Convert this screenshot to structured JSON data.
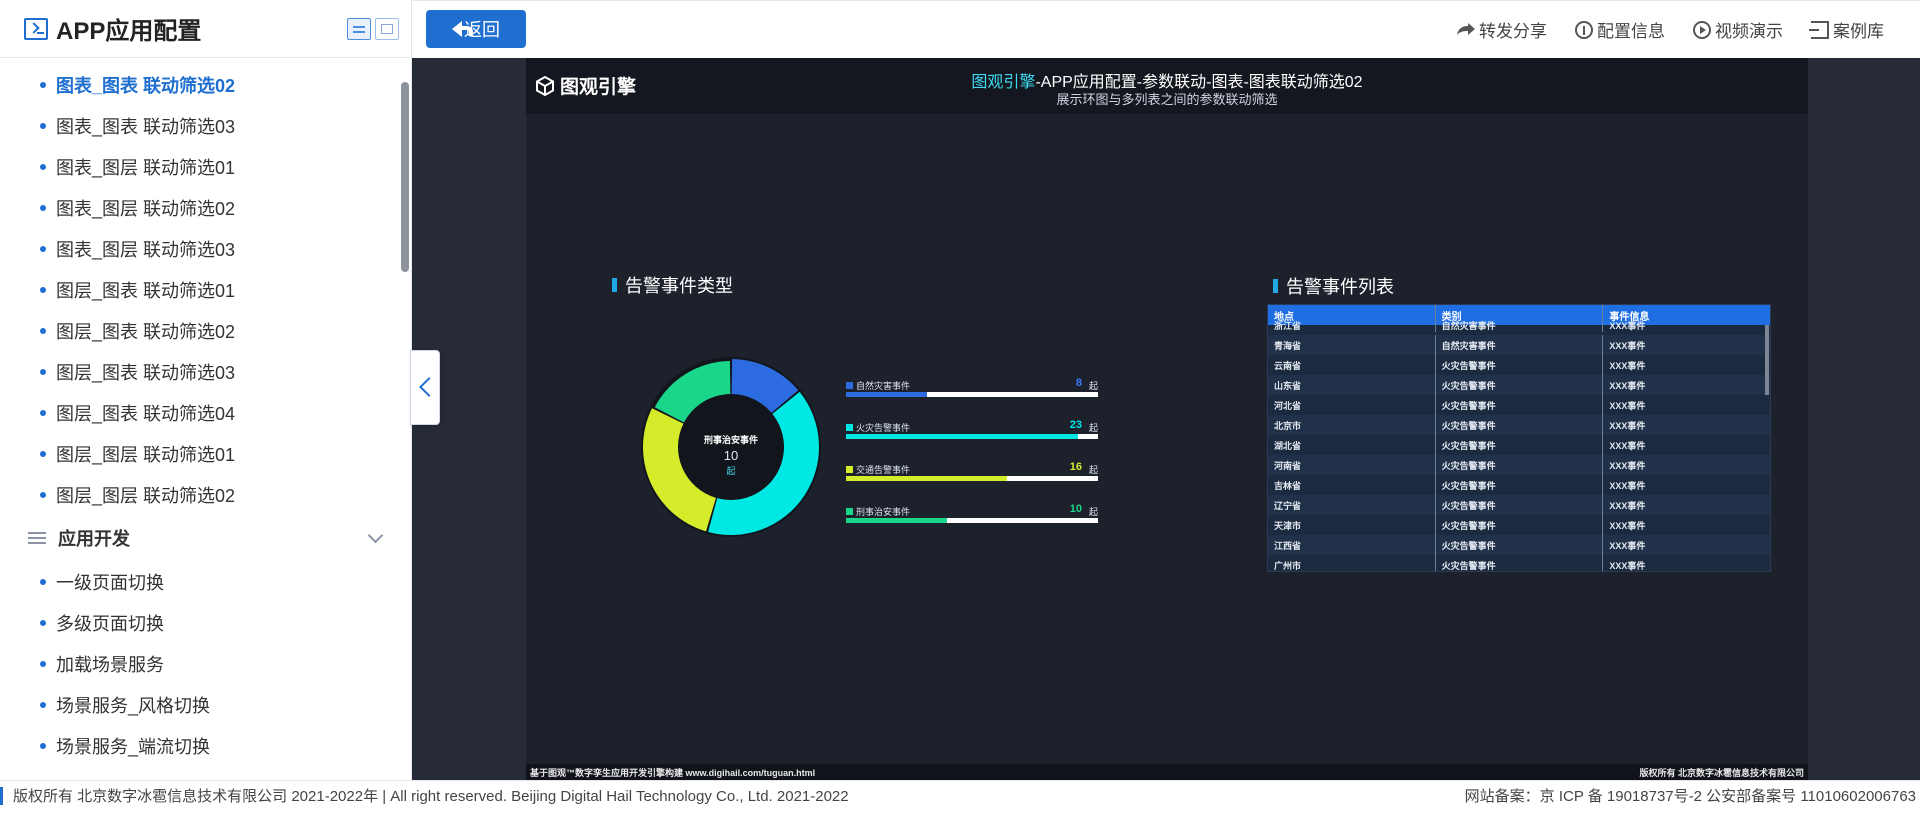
{
  "sidebar": {
    "title": "APP应用配置",
    "items": [
      {
        "label": "图表_图表 联动筛选02",
        "active": true
      },
      {
        "label": "图表_图表 联动筛选03"
      },
      {
        "label": "图表_图层 联动筛选01"
      },
      {
        "label": "图表_图层 联动筛选02"
      },
      {
        "label": "图表_图层 联动筛选03"
      },
      {
        "label": "图层_图表 联动筛选01"
      },
      {
        "label": "图层_图表 联动筛选02"
      },
      {
        "label": "图层_图表 联动筛选03"
      },
      {
        "label": "图层_图表 联动筛选04"
      },
      {
        "label": "图层_图层 联动筛选01"
      },
      {
        "label": "图层_图层 联动筛选02"
      }
    ],
    "group": {
      "label": "应用开发"
    },
    "group_items": [
      {
        "label": "一级页面切换"
      },
      {
        "label": "多级页面切换"
      },
      {
        "label": "加载场景服务"
      },
      {
        "label": "场景服务_风格切换"
      },
      {
        "label": "场景服务_端流切换"
      }
    ]
  },
  "topbar": {
    "back_label": "返回",
    "actions": [
      "转发分享",
      "配置信息",
      "视频演示",
      "案例库"
    ]
  },
  "dashboard": {
    "logo": "图观引擎",
    "title_highlight": "图观引擎",
    "title_rest": "-APP应用配置-参数联动-图表-图表联动筛选02",
    "subtitle": "展示环图与多列表之间的参数联动筛选",
    "left_panel_title": "告警事件类型",
    "right_panel_title": "告警事件列表",
    "footer_left": "基于图观™数字孪生应用开发引擎构建 www.digihail.com/tuguan.html",
    "footer_right": "版权所有 北京数字冰雹信息技术有限公司",
    "center_label": "刑事治安事件",
    "center_value": "10",
    "center_unit": "起"
  },
  "chart_data": {
    "type": "pie",
    "variant": "donut",
    "unit": "起",
    "categories": [
      "自然灾害事件",
      "火灾告警事件",
      "交通告警事件",
      "刑事治安事件"
    ],
    "values": [
      8,
      23,
      16,
      10
    ],
    "colors": [
      "#2d6ce0",
      "#00e8e4",
      "#d4ec2a",
      "#1ad68a"
    ],
    "value_colors": [
      "#3f7bff",
      "#00e8e4",
      "#d4ec2a",
      "#1ad68a"
    ],
    "highlight": "刑事治安事件"
  },
  "table": {
    "headers": [
      "地点",
      "类别",
      "事件信息"
    ],
    "rows": [
      [
        "浙江省",
        "自然灾害事件",
        "XXX事件"
      ],
      [
        "青海省",
        "自然灾害事件",
        "XXX事件"
      ],
      [
        "云南省",
        "火灾告警事件",
        "XXX事件"
      ],
      [
        "山东省",
        "火灾告警事件",
        "XXX事件"
      ],
      [
        "河北省",
        "火灾告警事件",
        "XXX事件"
      ],
      [
        "北京市",
        "火灾告警事件",
        "XXX事件"
      ],
      [
        "湖北省",
        "火灾告警事件",
        "XXX事件"
      ],
      [
        "河南省",
        "火灾告警事件",
        "XXX事件"
      ],
      [
        "吉林省",
        "火灾告警事件",
        "XXX事件"
      ],
      [
        "辽宁省",
        "火灾告警事件",
        "XXX事件"
      ],
      [
        "天津市",
        "火灾告警事件",
        "XXX事件"
      ],
      [
        "江西省",
        "火灾告警事件",
        "XXX事件"
      ],
      [
        "广州市",
        "火灾告警事件",
        "XXX事件"
      ]
    ]
  },
  "footer": {
    "copyright": "版权所有 北京数字冰雹信息技术有限公司 2021-2022年 | All right reserved. Beijing Digital Hail Technology Co., Ltd. 2021-2022",
    "icp": "网站备案：京 ICP 备 19018737号-2 公安部备案号 11010602006763"
  }
}
